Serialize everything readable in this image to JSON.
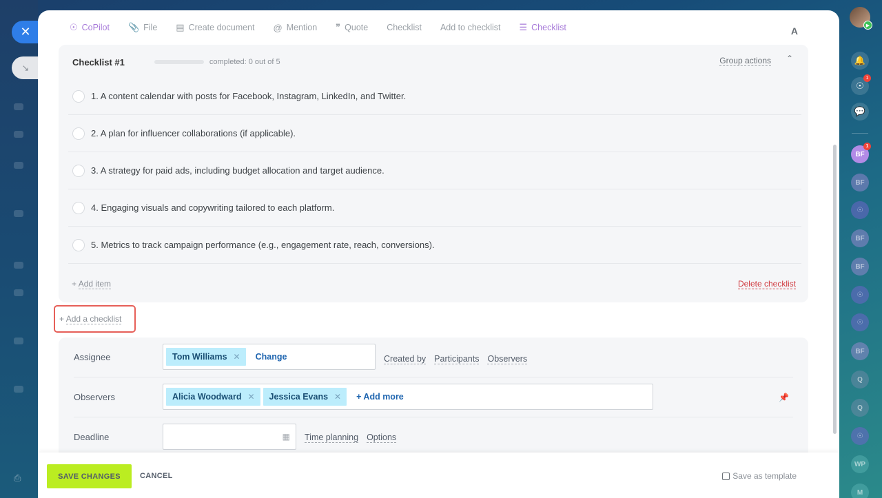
{
  "toolbar": {
    "copilot": "CoPilot",
    "file": "File",
    "create_document": "Create document",
    "mention": "Mention",
    "quote": "Quote",
    "checklist": "Checklist",
    "add_to_checklist": "Add to checklist",
    "checklist_active": "Checklist",
    "font": "A"
  },
  "checklist": {
    "title": "Checklist #1",
    "status": "completed: 0 out of 5",
    "progress": 0,
    "group_actions": "Group actions",
    "items": [
      "1. A content calendar with posts for Facebook, Instagram, LinkedIn, and Twitter.",
      "2. A plan for influencer collaborations (if applicable).",
      "3. A strategy for paid ads, including budget allocation and target audience.",
      "4. Engaging visuals and copywriting tailored to each platform.",
      "5. Metrics to track campaign performance (e.g., engagement rate, reach, conversions)."
    ],
    "add_item_plus": "+",
    "add_item": "Add item",
    "delete": "Delete checklist"
  },
  "add_checklist": {
    "plus": "+",
    "label": "Add a checklist"
  },
  "props": {
    "assignee": {
      "label": "Assignee",
      "tags": [
        "Tom Williams"
      ],
      "action": "Change",
      "links": [
        "Created by",
        "Participants",
        "Observers"
      ]
    },
    "observers": {
      "label": "Observers",
      "tags": [
        "Alicia Woodward",
        "Jessica Evans"
      ],
      "action": "+ Add more"
    },
    "deadline": {
      "label": "Deadline",
      "value": "",
      "links": [
        "Time planning",
        "Options"
      ]
    }
  },
  "footer": {
    "save": "SAVE CHANGES",
    "cancel": "CANCEL",
    "save_template": "Save as template"
  },
  "right_bar": {
    "notif_badge": "1",
    "copilot_badge": "1",
    "users": [
      {
        "initials": "BF",
        "type": "bf",
        "active": true,
        "badge": "1"
      },
      {
        "initials": "BF",
        "type": "bf"
      },
      {
        "initials": "",
        "type": "cp"
      },
      {
        "initials": "BF",
        "type": "bf"
      },
      {
        "initials": "BF",
        "type": "bf"
      },
      {
        "initials": "",
        "type": "cp"
      },
      {
        "initials": "",
        "type": "cp"
      },
      {
        "initials": "BF",
        "type": "bf"
      },
      {
        "initials": "Q",
        "type": "q"
      },
      {
        "initials": "Q",
        "type": "q"
      },
      {
        "initials": "",
        "type": "cp"
      },
      {
        "initials": "WP",
        "type": "wp"
      },
      {
        "initials": "M",
        "type": "wp"
      }
    ]
  },
  "colors": {
    "accent_green": "#bbed21",
    "delete_red": "#d0393e",
    "tag_blue": "#bcedfc",
    "highlight_red": "#e65f58",
    "copilot_purple": "#a77ad9"
  }
}
